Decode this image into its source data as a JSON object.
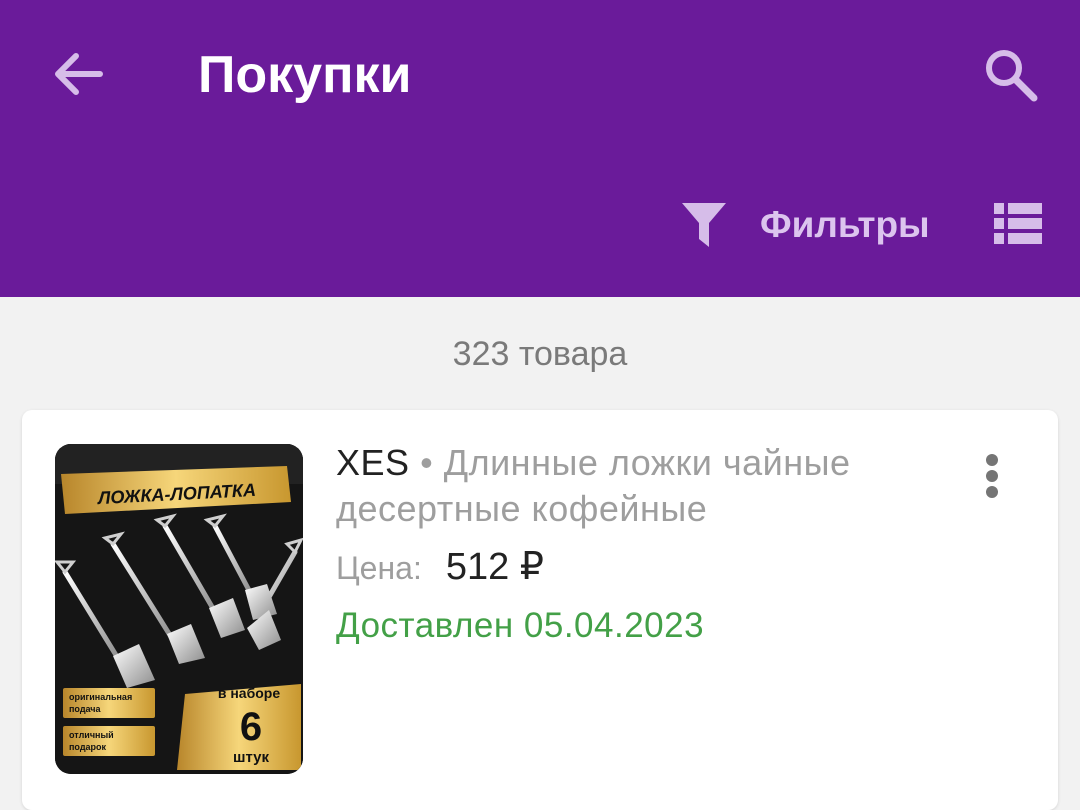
{
  "header": {
    "title": "Покупки",
    "back_icon": "arrow-left-icon",
    "search_icon": "search-icon",
    "filters_label": "Фильтры",
    "filter_icon": "filter-funnel-icon",
    "view_icon": "list-view-icon",
    "background_color": "#6a1b9a"
  },
  "summary": {
    "count_text": "323 товара"
  },
  "items": [
    {
      "brand": "XES",
      "separator": "•",
      "name": "Длинные ложки чайные десертные кофейные",
      "price_label": "Цена:",
      "price": "512 ₽",
      "status": "Доставлен 05.04.2023",
      "status_color": "#43a047",
      "menu_icon": "more-vertical-icon",
      "image": {
        "banner": "ЛОЖКА-ЛОПАТКА",
        "badge_top": "в наборе",
        "badge_number": "6",
        "badge_bottom": "штук",
        "tag1_line1": "оригинальная",
        "tag1_line2": "подача",
        "tag2_line1": "отличный",
        "tag2_line2": "подарок"
      }
    }
  ]
}
